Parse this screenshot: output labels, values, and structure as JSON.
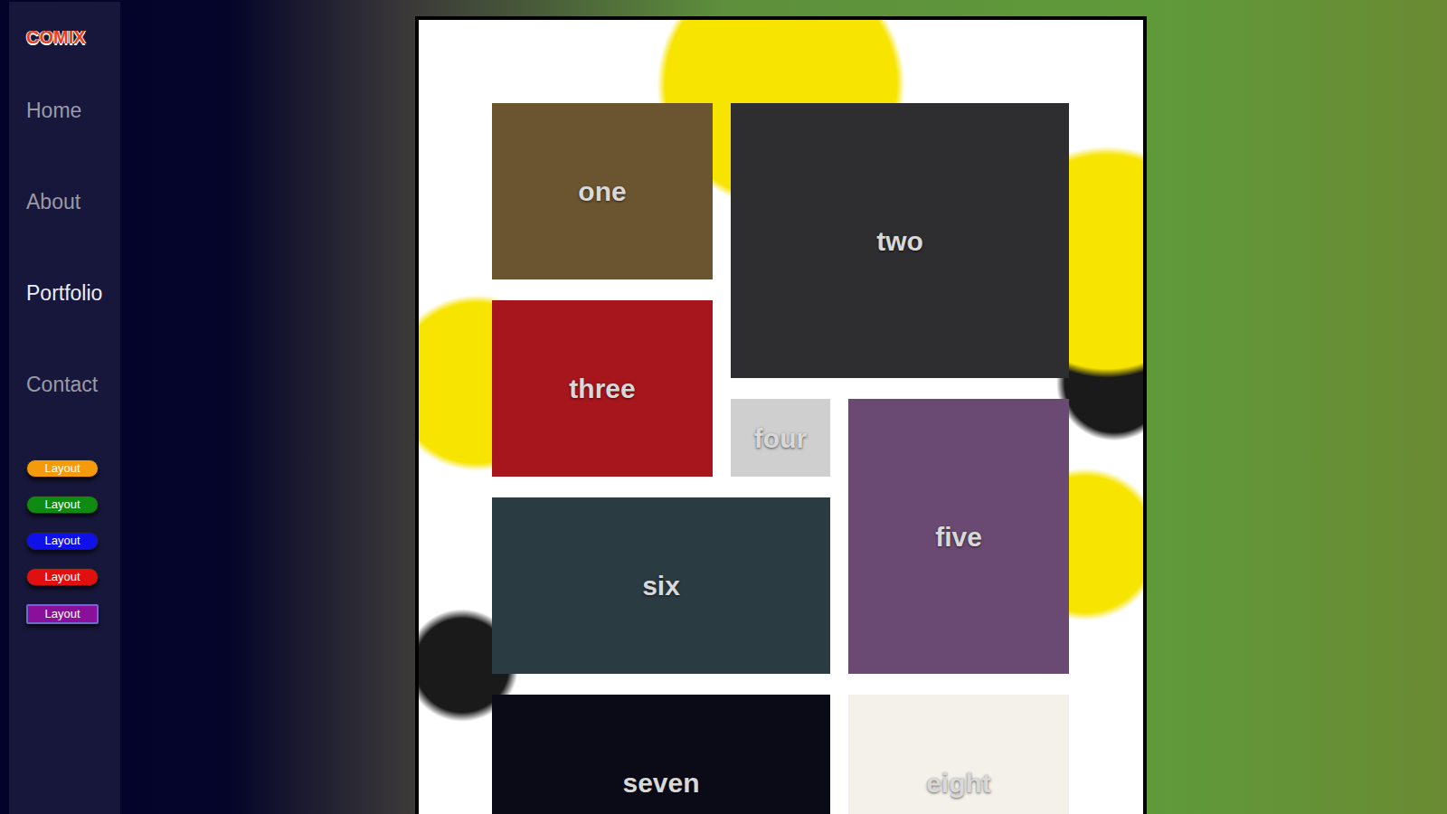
{
  "logo": "COMIX",
  "nav": [
    {
      "label": "Home",
      "selected": false
    },
    {
      "label": "About",
      "selected": false
    },
    {
      "label": "Portfolio",
      "selected": true
    },
    {
      "label": "Contact",
      "selected": false
    }
  ],
  "layout_buttons": [
    {
      "label": "Layout",
      "color": "#f59a0c",
      "selected": false
    },
    {
      "label": "Layout",
      "color": "#0f8a12",
      "selected": false
    },
    {
      "label": "Layout",
      "color": "#1010e8",
      "selected": false
    },
    {
      "label": "Layout",
      "color": "#e01010",
      "selected": false
    },
    {
      "label": "Layout",
      "color": "#8a0f9a",
      "selected": true
    }
  ],
  "tiles": [
    {
      "label": "one",
      "color": "#6b5530"
    },
    {
      "label": "two",
      "color": "#2e2e31"
    },
    {
      "label": "three",
      "color": "#a8161d"
    },
    {
      "label": "four",
      "color": "#cfcfcf"
    },
    {
      "label": "five",
      "color": "#6a4a72"
    },
    {
      "label": "six",
      "color": "#2b3b42"
    },
    {
      "label": "seven",
      "color": "#0b0b18"
    },
    {
      "label": "eight",
      "color": "#f4f1ea"
    }
  ]
}
